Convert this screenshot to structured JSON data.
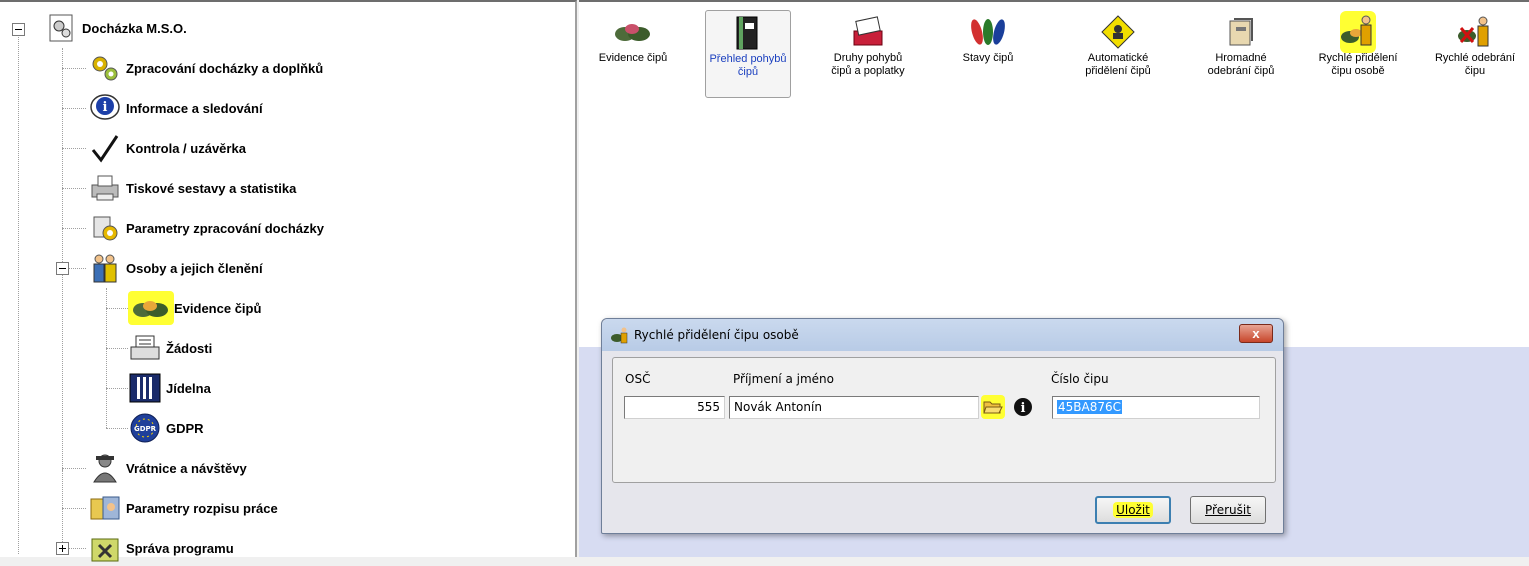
{
  "tree": {
    "root": {
      "label": "Docházka M.S.O.",
      "icon": "gear-document-icon"
    },
    "items": [
      {
        "label": "Zpracování docházky a doplňků",
        "icon": "gears-icon"
      },
      {
        "label": "Informace a sledování",
        "icon": "info-icon"
      },
      {
        "label": "Kontrola / uzávěrka",
        "icon": "checkmark-icon"
      },
      {
        "label": "Tiskové sestavy a statistika",
        "icon": "printer-icon"
      },
      {
        "label": "Parametry zpracování docházky",
        "icon": "settings-icon"
      },
      {
        "label": "Osoby a jejich členění",
        "icon": "people-icon"
      },
      {
        "label": "Evidence čipů",
        "icon": "chip-tokens-icon"
      },
      {
        "label": "Žádosti",
        "icon": "requests-icon"
      },
      {
        "label": "Jídelna",
        "icon": "cutlery-icon"
      },
      {
        "label": "GDPR",
        "icon": "gdpr-icon"
      },
      {
        "label": "Vrátnice a návštěvy",
        "icon": "guard-icon"
      },
      {
        "label": "Parametry rozpisu práce",
        "icon": "work-schedule-icon"
      },
      {
        "label": "Správa programu",
        "icon": "tools-icon"
      }
    ]
  },
  "toolbar": [
    {
      "label": "Evidence čipů",
      "icon": "chip-tokens-icon"
    },
    {
      "label": "Přehled pohybů čipů",
      "icon": "binder-icon"
    },
    {
      "label": "Druhy pohybů čipů a poplatky",
      "icon": "card-stack-icon"
    },
    {
      "label": "Stavy čipů",
      "icon": "chip-states-icon"
    },
    {
      "label": "Automatické přidělení čipů",
      "icon": "auto-assign-icon"
    },
    {
      "label": "Hromadné odebrání čipů",
      "icon": "bulk-remove-icon"
    },
    {
      "label": "Rychlé přidělení čipu osobě",
      "icon": "quick-assign-icon"
    },
    {
      "label": "Rychlé odebrání čipu",
      "icon": "quick-remove-icon"
    }
  ],
  "dialog": {
    "title": "Rychlé přidělení čipu osobě",
    "close_label": "x",
    "labels": {
      "osc": "OSČ",
      "name": "Příjmení a jméno",
      "chip": "Číslo čipu"
    },
    "values": {
      "osc": "555",
      "name": "Novák Antonín",
      "chip": "45BA876C"
    },
    "buttons": {
      "save": "Uložit",
      "cancel": "Přerušit"
    }
  },
  "colors": {
    "highlight": "#ffff33",
    "selection": "#3399ff",
    "lower_panel": "#d7dcf2"
  }
}
